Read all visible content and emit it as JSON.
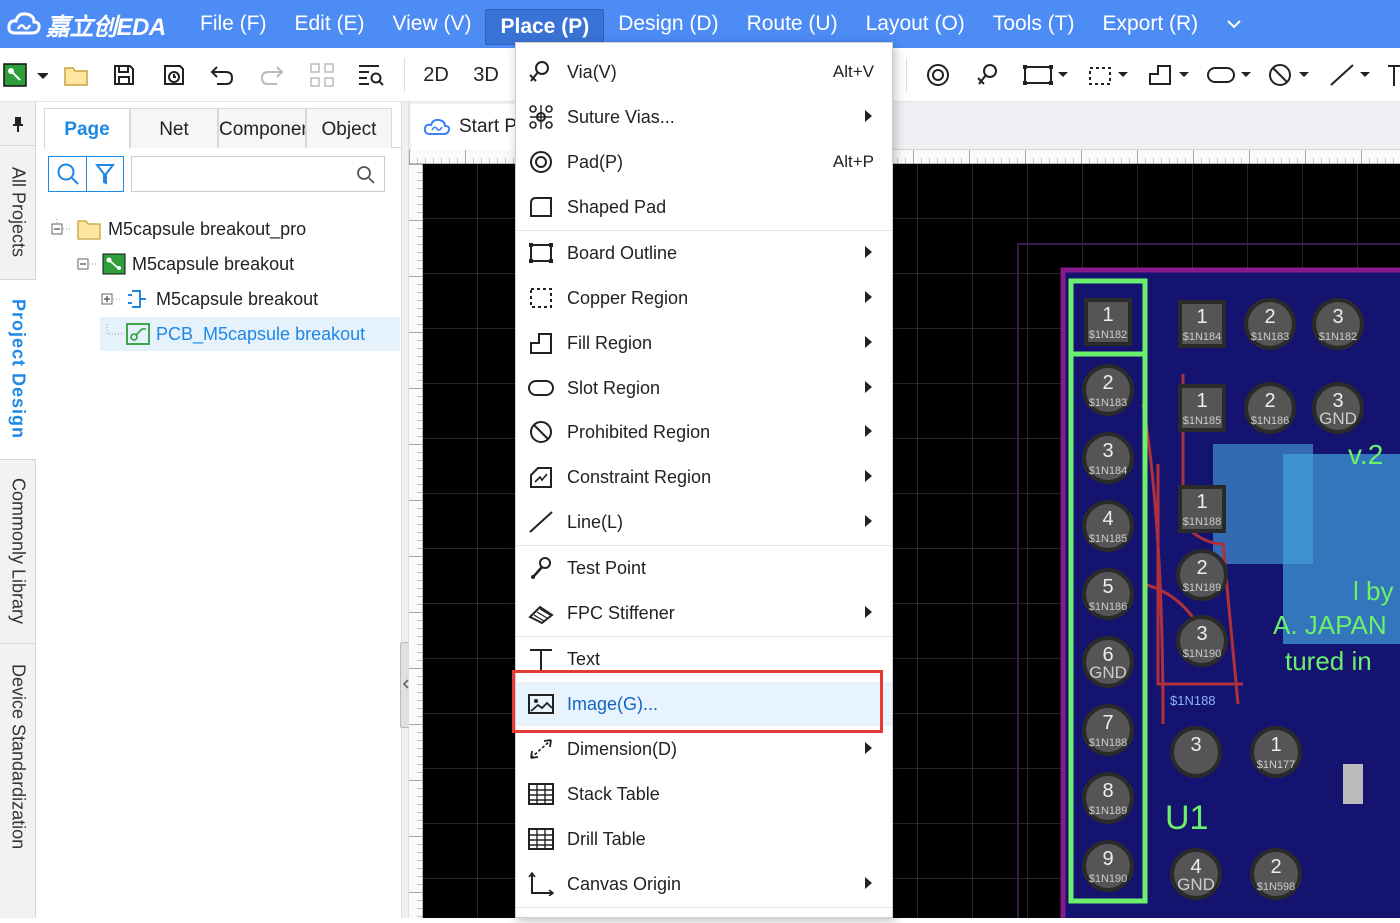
{
  "app": {
    "logo_text": "嘉立创EDA"
  },
  "menubar": [
    {
      "label": "File (F)"
    },
    {
      "label": "Edit (E)"
    },
    {
      "label": "View (V)"
    },
    {
      "label": "Place (P)",
      "active": true
    },
    {
      "label": "Design (D)"
    },
    {
      "label": "Route (U)"
    },
    {
      "label": "Layout (O)"
    },
    {
      "label": "Tools (T)"
    },
    {
      "label": "Export (R)"
    }
  ],
  "toolbar": {
    "view_2d": "2D",
    "view_3d": "3D"
  },
  "left_tabs": [
    {
      "label": "All Projects"
    },
    {
      "label": "Project Design",
      "active": true
    },
    {
      "label": "Commonly Library"
    },
    {
      "label": "Device Standardization"
    }
  ],
  "panel": {
    "tabs": [
      {
        "label": "Page",
        "active": true
      },
      {
        "label": "Net"
      },
      {
        "label": "Componen"
      },
      {
        "label": "Object"
      }
    ],
    "search": {
      "value": "",
      "placeholder": ""
    },
    "tree": [
      {
        "label": "M5capsule breakout_pro",
        "icon": "folder-icon"
      },
      {
        "label": "M5capsule breakout",
        "icon": "board-icon"
      },
      {
        "label": "M5capsule breakout",
        "icon": "schematic-icon"
      },
      {
        "label": "PCB_M5capsule breakout",
        "icon": "pcb-icon",
        "selected": true
      }
    ]
  },
  "doc_tabs": [
    {
      "label": "Start P"
    }
  ],
  "place_menu": {
    "items": [
      {
        "label": "Via(V)",
        "shortcut": "Alt+V",
        "icon": "via-icon",
        "submenu": false
      },
      {
        "label": "Suture Vias...",
        "shortcut": "",
        "icon": "suture-vias-icon",
        "submenu": true
      },
      {
        "label": "Pad(P)",
        "shortcut": "Alt+P",
        "icon": "pad-icon",
        "submenu": false
      },
      {
        "label": "Shaped Pad",
        "shortcut": "",
        "icon": "shaped-pad-icon",
        "submenu": false
      },
      {
        "label": "Board Outline",
        "shortcut": "",
        "icon": "board-outline-icon",
        "submenu": true
      },
      {
        "label": "Copper Region",
        "shortcut": "",
        "icon": "copper-region-icon",
        "submenu": true
      },
      {
        "label": "Fill Region",
        "shortcut": "",
        "icon": "fill-region-icon",
        "submenu": true
      },
      {
        "label": "Slot Region",
        "shortcut": "",
        "icon": "slot-region-icon",
        "submenu": true
      },
      {
        "label": "Prohibited Region",
        "shortcut": "",
        "icon": "prohibited-region-icon",
        "submenu": true
      },
      {
        "label": "Constraint Region",
        "shortcut": "",
        "icon": "constraint-region-icon",
        "submenu": true
      },
      {
        "label": "Line(L)",
        "shortcut": "",
        "icon": "line-icon",
        "submenu": true
      },
      {
        "label": "Test Point",
        "shortcut": "",
        "icon": "test-point-icon",
        "submenu": false
      },
      {
        "label": "FPC Stiffener",
        "shortcut": "",
        "icon": "fpc-stiffener-icon",
        "submenu": true
      },
      {
        "label": "Text",
        "shortcut": "",
        "icon": "text-icon",
        "submenu": false
      },
      {
        "label": "Image(G)...",
        "shortcut": "",
        "icon": "image-icon",
        "submenu": false,
        "highlighted": true
      },
      {
        "label": "Dimension(D)",
        "shortcut": "",
        "icon": "dimension-icon",
        "submenu": true
      },
      {
        "label": "Stack Table",
        "shortcut": "",
        "icon": "stack-table-icon",
        "submenu": false
      },
      {
        "label": "Drill Table",
        "shortcut": "",
        "icon": "drill-table-icon",
        "submenu": false
      },
      {
        "label": "Canvas Origin",
        "shortcut": "",
        "icon": "canvas-origin-icon",
        "submenu": true
      }
    ]
  },
  "pcb": {
    "left_header_pads": [
      {
        "num": "1",
        "net": "$1N182"
      },
      {
        "num": "2",
        "net": "$1N183"
      },
      {
        "num": "3",
        "net": "$1N184"
      },
      {
        "num": "4",
        "net": "$1N185"
      },
      {
        "num": "5",
        "net": "$1N186"
      },
      {
        "num": "6",
        "net": "GND"
      },
      {
        "num": "7",
        "net": "$1N188"
      },
      {
        "num": "8",
        "net": "$1N189"
      },
      {
        "num": "9",
        "net": "$1N190"
      }
    ],
    "top_row1": [
      {
        "num": "1",
        "net": "$1N184"
      },
      {
        "num": "2",
        "net": "$1N183"
      },
      {
        "num": "3",
        "net": "$1N182"
      }
    ],
    "top_row2": [
      {
        "num": "1",
        "net": "$1N185"
      },
      {
        "num": "2",
        "net": "$1N186"
      },
      {
        "num": "3",
        "net": "GND"
      }
    ],
    "mid_column": [
      {
        "num": "1",
        "net": "$1N188"
      },
      {
        "num": "2",
        "net": "$1N189"
      },
      {
        "num": "3",
        "net": "$1N190"
      }
    ],
    "bottom_pads": [
      {
        "num": "3",
        "net": ""
      },
      {
        "num": "1",
        "net": "$1N177"
      },
      {
        "num": "4",
        "net": "GND"
      },
      {
        "num": "2",
        "net": "$1N598"
      }
    ],
    "net_label": "$1N188",
    "designator": "U1",
    "silk_lines": [
      "v.2",
      "l by",
      "A. JAPAN",
      "tured in"
    ]
  },
  "colors": {
    "menubar": "#4d8bf5",
    "accent": "#1e88e5",
    "highlight_box": "#e53935",
    "pcb_bg": "#000000",
    "board_fill": "#1a1a8c",
    "silk": "#6cf06c"
  }
}
